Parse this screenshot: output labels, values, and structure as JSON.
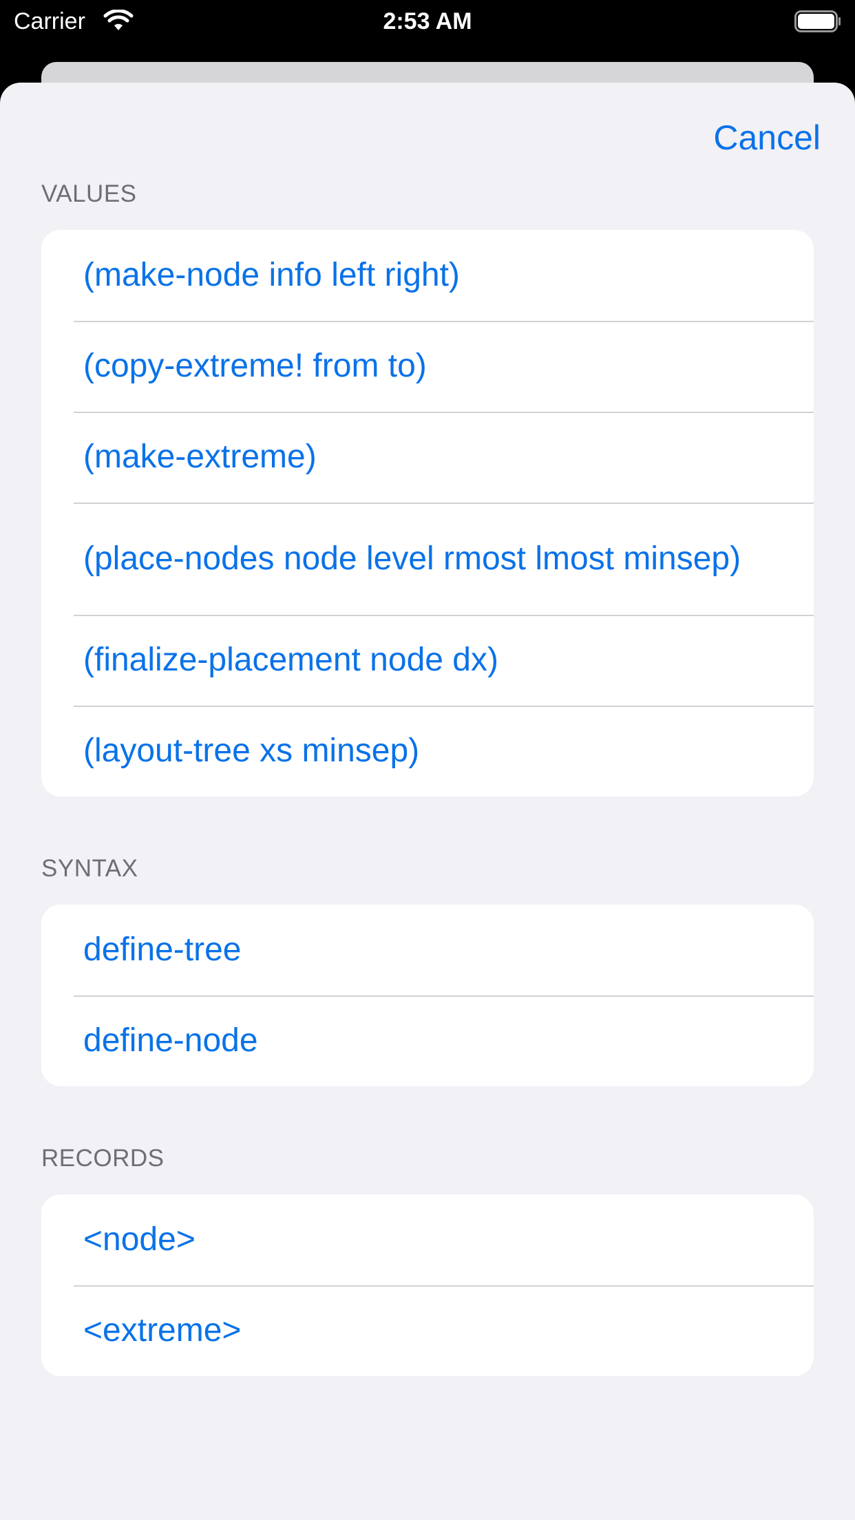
{
  "status_bar": {
    "carrier": "Carrier",
    "time": "2:53 AM",
    "wifi_icon": "wifi-icon",
    "battery_icon": "battery-full-icon"
  },
  "header": {
    "cancel_label": "Cancel"
  },
  "sections": {
    "values": {
      "title": "VALUES",
      "items": [
        "(make-node info left right)",
        "(copy-extreme! from to)",
        "(make-extreme)",
        "(place-nodes node level rmost lmost minsep)",
        "(finalize-placement node dx)",
        "(layout-tree xs minsep)"
      ]
    },
    "syntax": {
      "title": "SYNTAX",
      "items": [
        "define-tree",
        "define-node"
      ]
    },
    "records": {
      "title": "RECORDS",
      "items": [
        "<node>",
        "<extreme>"
      ]
    }
  },
  "colors": {
    "accent": "#0a72e8",
    "sheet_background": "#f1f1f6",
    "section_header": "#6e6e73"
  }
}
